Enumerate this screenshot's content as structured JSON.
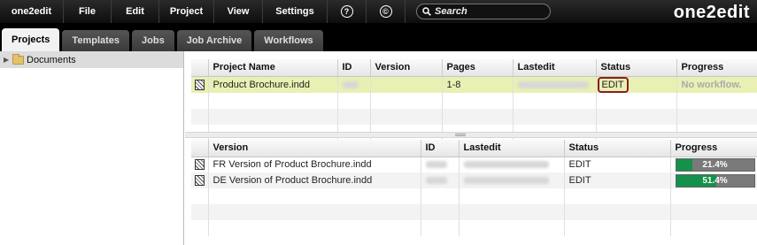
{
  "menu": {
    "items": [
      {
        "label": "one2edit"
      },
      {
        "label": "File"
      },
      {
        "label": "Edit"
      },
      {
        "label": "Project"
      },
      {
        "label": "View"
      },
      {
        "label": "Settings"
      }
    ],
    "help_icon": "?",
    "copyright_icon": "©",
    "search_placeholder": "Search"
  },
  "logo": "one2edit",
  "tabs": [
    "Projects",
    "Templates",
    "Jobs",
    "Job Archive",
    "Workflows"
  ],
  "tree": {
    "root_label": "Documents"
  },
  "projects_table": {
    "columns": [
      "Project Name",
      "ID",
      "Version",
      "Pages",
      "Lastedit",
      "Status",
      "Progress"
    ],
    "rows": [
      {
        "name": "Product Brochure.indd",
        "pages": "1-8",
        "status": "EDIT",
        "progress_text": "No workflow."
      }
    ]
  },
  "versions_table": {
    "columns": [
      "Version",
      "ID",
      "Lastedit",
      "Status",
      "Progress"
    ],
    "rows": [
      {
        "name": "FR Version of Product Brochure.indd",
        "status": "EDIT",
        "progress": 21.4,
        "progress_text": "21.4%"
      },
      {
        "name": "DE Version of Product Brochure.indd",
        "status": "EDIT",
        "progress": 51.4,
        "progress_text": "51.4%"
      }
    ]
  },
  "colors": {
    "accent_green": "#14914a",
    "selected_row": "#eaf0b3",
    "status_highlight": "#8b1d1d"
  }
}
